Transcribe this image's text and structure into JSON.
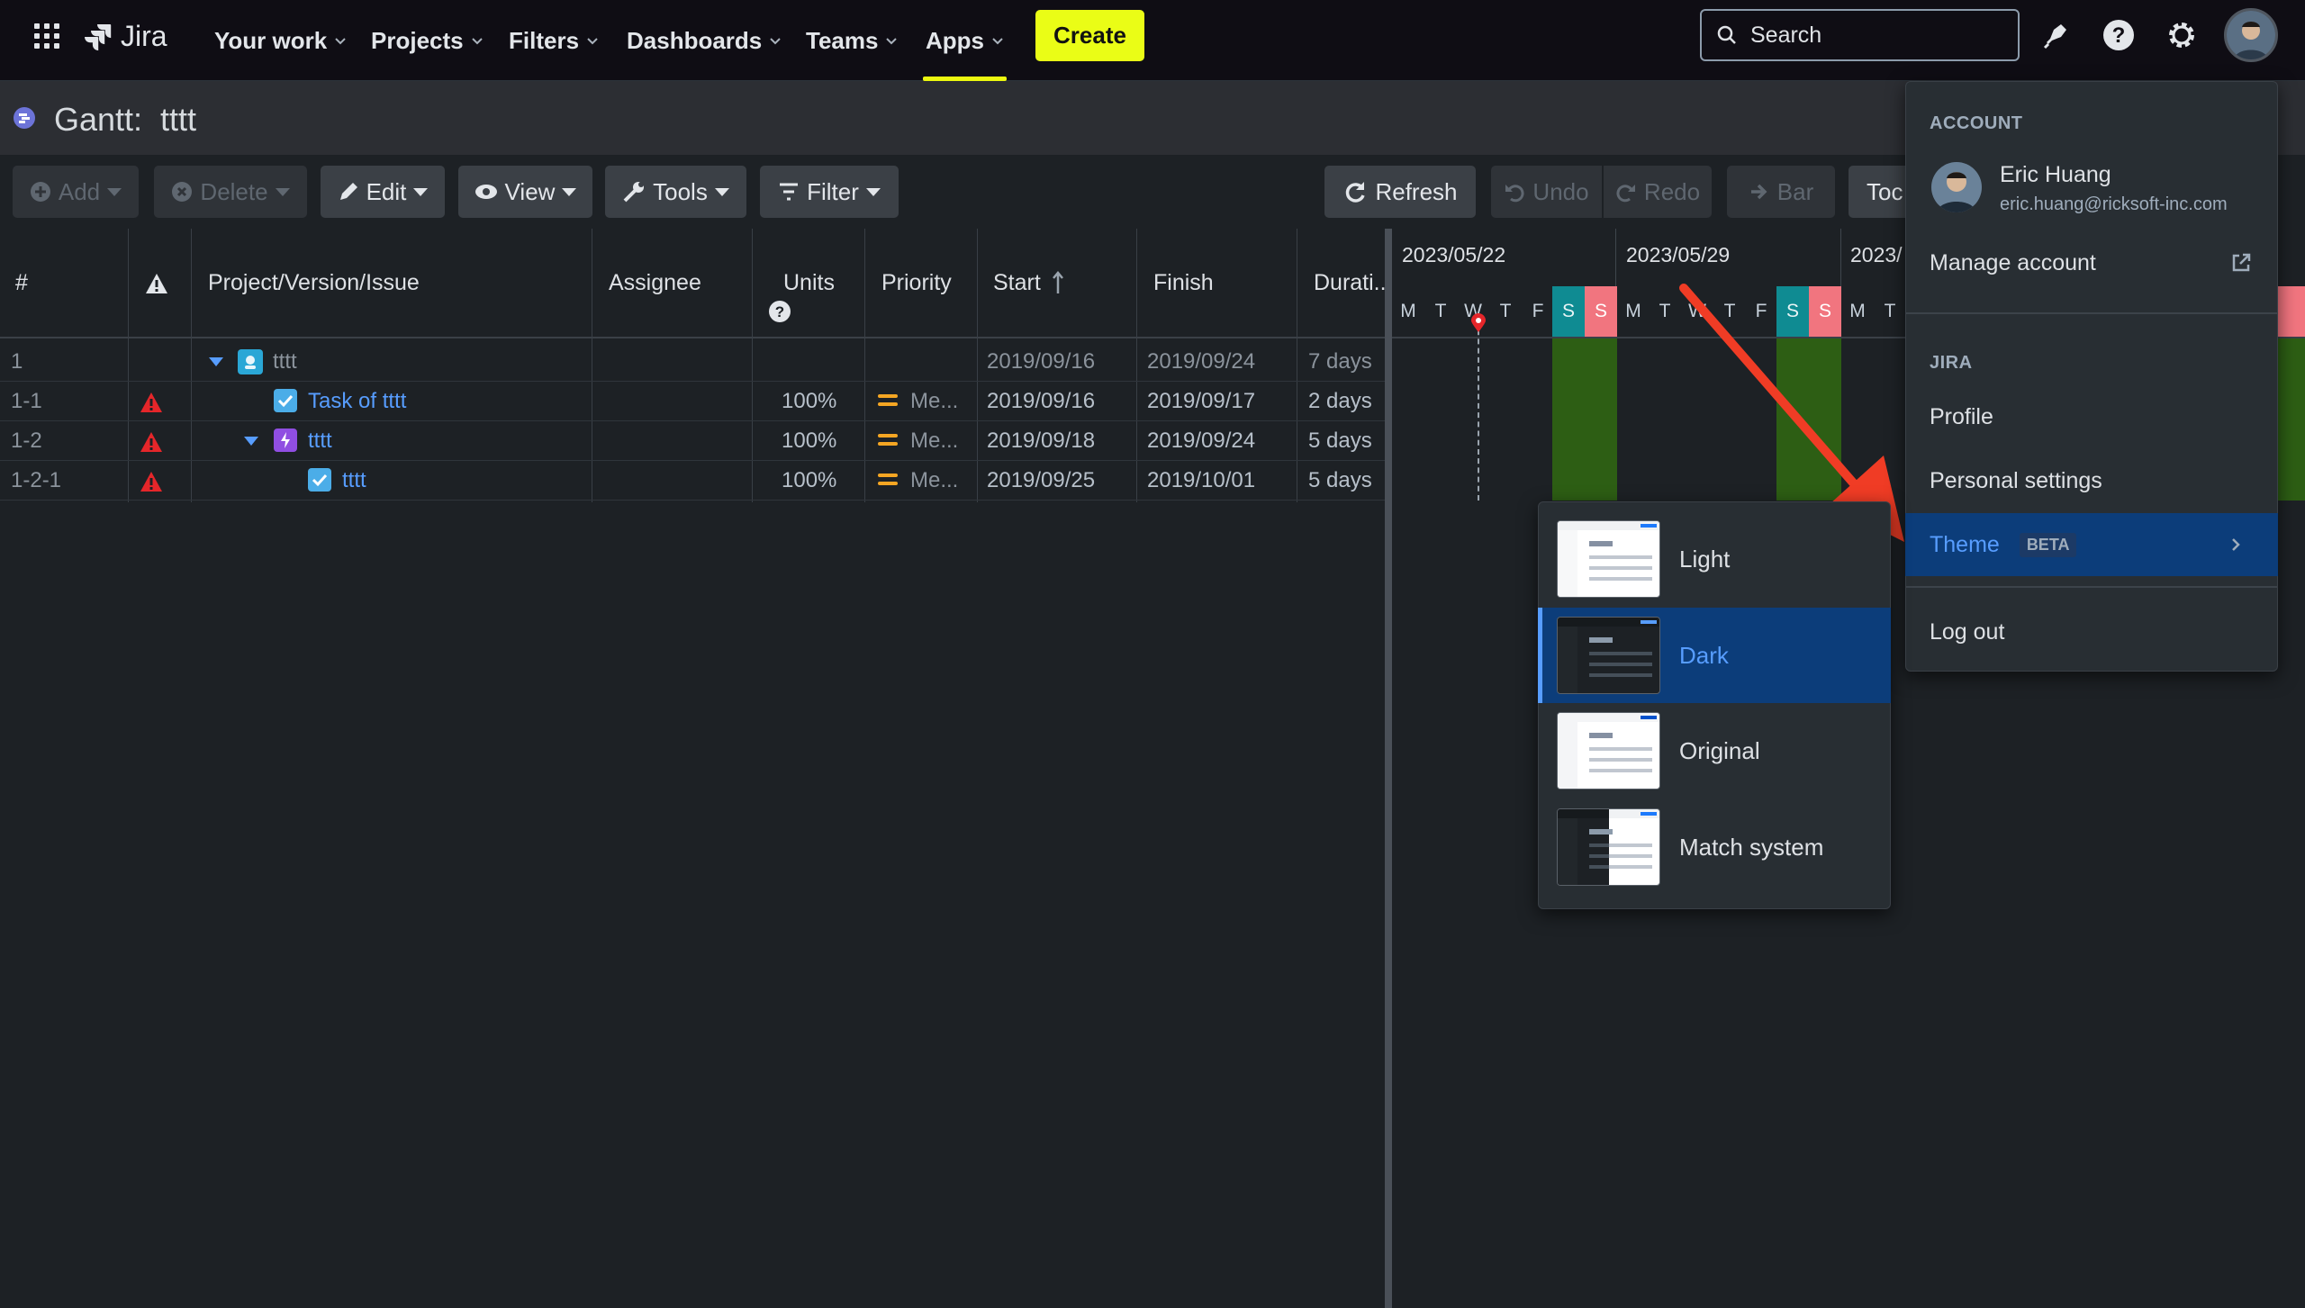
{
  "topnav": {
    "logo_text": "Jira",
    "items": [
      "Your work",
      "Projects",
      "Filters",
      "Dashboards",
      "Teams",
      "Apps"
    ],
    "active_item": "Apps",
    "create_label": "Create",
    "search_placeholder": "Search",
    "accent_color": "#eafd16"
  },
  "page": {
    "title": "Gantt:  tttt"
  },
  "toolbar": {
    "add": "Add",
    "delete": "Delete",
    "edit": "Edit",
    "view": "View",
    "tools": "Tools",
    "filter": "Filter",
    "refresh": "Refresh",
    "undo": "Undo",
    "redo": "Redo",
    "bar": "Bar",
    "today_partial": "Toc"
  },
  "grid": {
    "columns": [
      "#",
      "",
      "Project/Version/Issue",
      "Assignee",
      "Units",
      "Priority",
      "Start",
      "Finish",
      "Durati..."
    ],
    "rows": [
      {
        "num": "1",
        "name": "tttt",
        "units": "",
        "priority": "",
        "start": "2019/09/16",
        "finish": "2019/09/24",
        "duration": "7 days"
      },
      {
        "num": "1-1",
        "name": "Task of tttt",
        "units": "100%",
        "priority": "Me...",
        "start": "2019/09/16",
        "finish": "2019/09/17",
        "duration": "2 days"
      },
      {
        "num": "1-2",
        "name": "tttt",
        "units": "100%",
        "priority": "Me...",
        "start": "2019/09/18",
        "finish": "2019/09/24",
        "duration": "5 days"
      },
      {
        "num": "1-2-1",
        "name": "tttt",
        "units": "100%",
        "priority": "Me...",
        "start": "2019/09/25",
        "finish": "2019/10/01",
        "duration": "5 days"
      }
    ]
  },
  "gantt": {
    "weeks": [
      "2023/05/22",
      "2023/05/29",
      "2023/"
    ],
    "days": [
      "M",
      "T",
      "W",
      "T",
      "F",
      "S",
      "S",
      "M",
      "T",
      "W",
      "T",
      "F",
      "S",
      "S",
      "M",
      "T"
    ],
    "weekend_color": "#2d5e14",
    "saturday_color": "#0f8b92",
    "sunday_color": "#f1757f"
  },
  "account_menu": {
    "section_account": "ACCOUNT",
    "user_name": "Eric Huang",
    "user_email": "eric.huang@ricksoft-inc.com",
    "manage_account": "Manage account",
    "section_jira": "JIRA",
    "profile": "Profile",
    "personal_settings": "Personal settings",
    "theme": "Theme",
    "theme_badge": "BETA",
    "log_out": "Log out"
  },
  "theme_menu": {
    "options": [
      "Light",
      "Dark",
      "Original",
      "Match system"
    ],
    "selected": "Dark"
  }
}
